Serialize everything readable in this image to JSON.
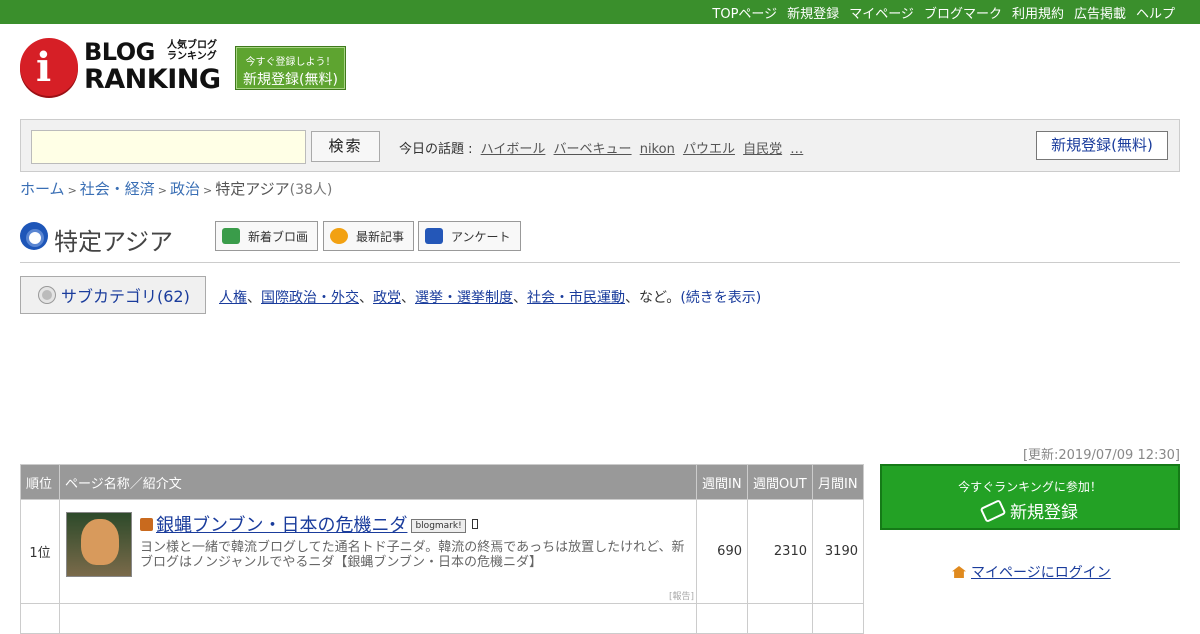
{
  "topnav": [
    "TOPページ",
    "新規登録",
    "マイページ",
    "ブログマーク",
    "利用規約",
    "広告掲載",
    "ヘルプ"
  ],
  "logo": {
    "blog": "BLOG",
    "ranking": "RANKING",
    "small": "人気ブログランキング"
  },
  "signup_small": {
    "line1": "今すぐ登録しよう！",
    "line2": "新規登録(無料)"
  },
  "search": {
    "placeholder": "",
    "button": "検索"
  },
  "topics": {
    "label": "今日の話題 :",
    "items": [
      "ハイボール",
      "バーベキュー",
      "nikon",
      "パウエル",
      "自民党",
      "…"
    ]
  },
  "signup_right": "新規登録(無料)",
  "breadcrumb": {
    "home": "ホーム",
    "level1": "社会・経済",
    "level2": "政治",
    "current": "特定アジア",
    "count": "(38人)"
  },
  "category": {
    "title": "特定アジア",
    "buttons": [
      "新着ブロ画",
      "最新記事",
      "アンケート"
    ]
  },
  "subcategory": {
    "button": "サブカテゴリ(62)",
    "links": [
      "人権",
      "国際政治・外交",
      "政党",
      "選挙・選挙制度",
      "社会・市民運動"
    ],
    "suffix": "、など。",
    "more": "(続きを表示)"
  },
  "updated": "[更新:2019/07/09 12:30]",
  "table": {
    "headers": [
      "順位",
      "ページ名称／紹介文",
      "週間IN",
      "週間OUT",
      "月間IN"
    ],
    "rows": [
      {
        "rank": "1位",
        "title": "銀蝿ブンブン・日本の危機ニダ",
        "badge": "blogmark!",
        "desc": "ヨン様と一緒で韓流ブログしてた通名トド子ニダ。韓流の終焉であっちは放置したけれど、新ブログはノンジャンルでやるニダ【銀蝿ブンブン・日本の危機ニダ】",
        "report": "[報告]",
        "week_in": "690",
        "week_out": "2310",
        "month_in": "3190"
      }
    ]
  },
  "join": {
    "line1": "今すぐランキングに参加！",
    "line2": "新規登録"
  },
  "login": "マイページにログイン"
}
